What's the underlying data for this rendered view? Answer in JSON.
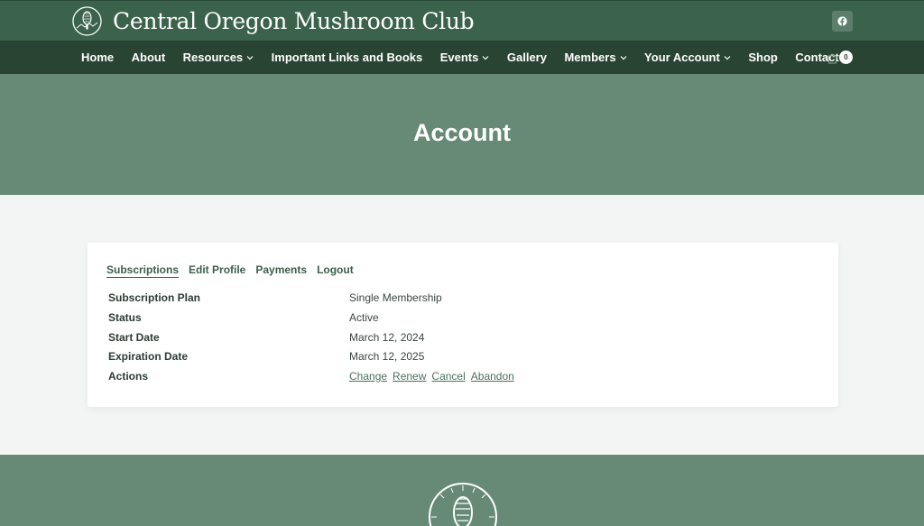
{
  "header": {
    "site_title": "Central Oregon Mushroom Club",
    "logo_icon": "mushroom-logo-icon",
    "social_icon": "facebook-icon"
  },
  "nav": {
    "items": [
      {
        "label": "Home",
        "has_dropdown": false
      },
      {
        "label": "About",
        "has_dropdown": false
      },
      {
        "label": "Resources",
        "has_dropdown": true
      },
      {
        "label": "Important Links and Books",
        "has_dropdown": false
      },
      {
        "label": "Events",
        "has_dropdown": true
      },
      {
        "label": "Gallery",
        "has_dropdown": false
      },
      {
        "label": "Members",
        "has_dropdown": true
      },
      {
        "label": "Your Account",
        "has_dropdown": true
      },
      {
        "label": "Shop",
        "has_dropdown": false
      },
      {
        "label": "Contact",
        "has_dropdown": false
      }
    ],
    "cart_count": "0"
  },
  "hero": {
    "title": "Account"
  },
  "account": {
    "tabs": [
      {
        "label": "Subscriptions",
        "active": true
      },
      {
        "label": "Edit Profile",
        "active": false
      },
      {
        "label": "Payments",
        "active": false
      },
      {
        "label": "Logout",
        "active": false
      }
    ],
    "rows": [
      {
        "label": "Subscription Plan",
        "value": "Single Membership"
      },
      {
        "label": "Status",
        "value": "Active"
      },
      {
        "label": "Start Date",
        "value": "March 12, 2024"
      },
      {
        "label": "Expiration Date",
        "value": "March 12, 2025"
      }
    ],
    "actions_label": "Actions",
    "actions": [
      "Change",
      "Renew",
      "Cancel",
      "Abandon"
    ]
  },
  "colors": {
    "topbar": "#3b634c",
    "navbar": "#2a4434",
    "hero": "#668a76",
    "accent_link": "#4d7060"
  }
}
